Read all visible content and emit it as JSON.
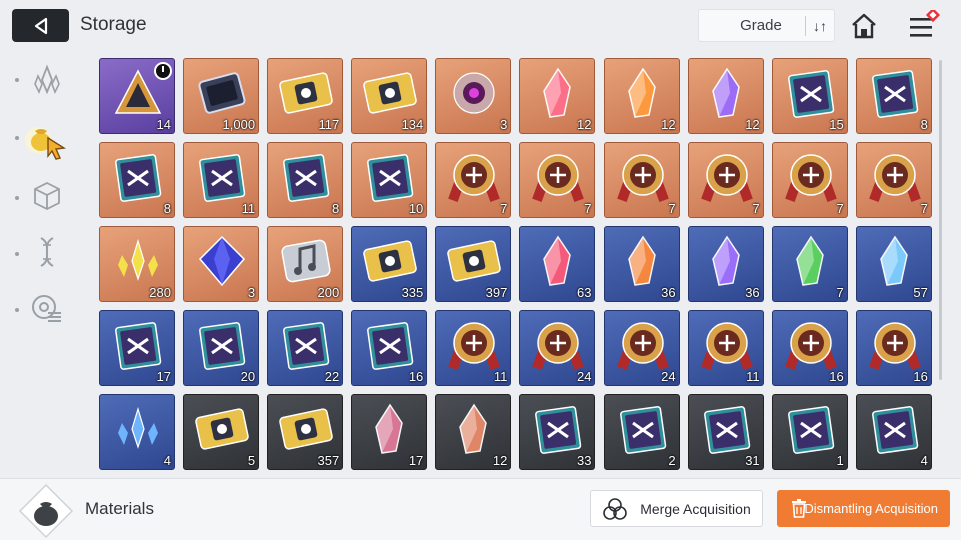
{
  "header": {
    "title": "Storage",
    "sort_label": "Grade",
    "sort_icon": "↓↑"
  },
  "sidebar": {
    "items": [
      {
        "icon": "crystal-icon",
        "active": false
      },
      {
        "icon": "pouch-icon",
        "active": true
      },
      {
        "icon": "cube-icon",
        "active": false
      },
      {
        "icon": "dna-icon",
        "active": false
      },
      {
        "icon": "gear-list-icon",
        "active": false
      }
    ]
  },
  "items": [
    {
      "rarity": "purple",
      "icon": "triangle-token-icon",
      "qty": "14",
      "timer": true
    },
    {
      "rarity": "orange",
      "icon": "chip-icon",
      "qty": "1,000"
    },
    {
      "rarity": "orange",
      "icon": "ticket-icon",
      "qty": "117"
    },
    {
      "rarity": "orange",
      "icon": "ticket-icon",
      "qty": "134"
    },
    {
      "rarity": "orange",
      "icon": "eye-orb-icon",
      "qty": "3"
    },
    {
      "rarity": "orange",
      "icon": "crystal-icon",
      "qty": "12",
      "color": "#ff6e8a"
    },
    {
      "rarity": "orange",
      "icon": "crystal-icon",
      "qty": "12",
      "color": "#ff9a3c"
    },
    {
      "rarity": "orange",
      "icon": "crystal-icon",
      "qty": "12",
      "color": "#9a6bff"
    },
    {
      "rarity": "orange",
      "icon": "book-icon",
      "qty": "15"
    },
    {
      "rarity": "orange",
      "icon": "book-icon",
      "qty": "8"
    },
    {
      "rarity": "orange",
      "icon": "book-icon",
      "qty": "8"
    },
    {
      "rarity": "orange",
      "icon": "book-icon",
      "qty": "11"
    },
    {
      "rarity": "orange",
      "icon": "book-icon",
      "qty": "8"
    },
    {
      "rarity": "orange",
      "icon": "book-icon",
      "qty": "10"
    },
    {
      "rarity": "orange",
      "icon": "medal-icon",
      "qty": "7"
    },
    {
      "rarity": "orange",
      "icon": "medal-icon",
      "qty": "7"
    },
    {
      "rarity": "orange",
      "icon": "medal-icon",
      "qty": "7"
    },
    {
      "rarity": "orange",
      "icon": "medal-icon",
      "qty": "7"
    },
    {
      "rarity": "orange",
      "icon": "medal-icon",
      "qty": "7"
    },
    {
      "rarity": "orange",
      "icon": "medal-icon",
      "qty": "7"
    },
    {
      "rarity": "orange",
      "icon": "shards-icon",
      "qty": "280",
      "color": "#f4e04a"
    },
    {
      "rarity": "orange",
      "icon": "octahedron-icon",
      "qty": "3"
    },
    {
      "rarity": "orange",
      "icon": "music-note-icon",
      "qty": "200"
    },
    {
      "rarity": "blue",
      "icon": "ticket-icon",
      "qty": "335"
    },
    {
      "rarity": "blue",
      "icon": "ticket-icon",
      "qty": "397"
    },
    {
      "rarity": "blue",
      "icon": "crystal-icon",
      "qty": "63",
      "color": "#ff5a78"
    },
    {
      "rarity": "blue",
      "icon": "crystal-icon",
      "qty": "36",
      "color": "#ff8a3a"
    },
    {
      "rarity": "blue",
      "icon": "crystal-icon",
      "qty": "36",
      "color": "#a070ff"
    },
    {
      "rarity": "blue",
      "icon": "crystal-icon",
      "qty": "7",
      "color": "#5cd65c"
    },
    {
      "rarity": "blue",
      "icon": "crystal-icon",
      "qty": "57",
      "color": "#7fd0ff"
    },
    {
      "rarity": "blue",
      "icon": "book-icon",
      "qty": "17"
    },
    {
      "rarity": "blue",
      "icon": "book-icon",
      "qty": "20"
    },
    {
      "rarity": "blue",
      "icon": "book-icon",
      "qty": "22"
    },
    {
      "rarity": "blue",
      "icon": "book-icon",
      "qty": "16"
    },
    {
      "rarity": "blue",
      "icon": "medal-icon",
      "qty": "11"
    },
    {
      "rarity": "blue",
      "icon": "medal-icon",
      "qty": "24"
    },
    {
      "rarity": "blue",
      "icon": "medal-icon",
      "qty": "24"
    },
    {
      "rarity": "blue",
      "icon": "medal-icon",
      "qty": "11"
    },
    {
      "rarity": "blue",
      "icon": "medal-icon",
      "qty": "16"
    },
    {
      "rarity": "blue",
      "icon": "medal-icon",
      "qty": "16"
    },
    {
      "rarity": "blue",
      "icon": "shards-icon",
      "qty": "4",
      "color": "#6fb4ff"
    },
    {
      "rarity": "gray",
      "icon": "ticket-icon",
      "qty": "5"
    },
    {
      "rarity": "gray",
      "icon": "ticket-icon",
      "qty": "357"
    },
    {
      "rarity": "gray",
      "icon": "crystal-icon",
      "qty": "17",
      "color": "#e07a9a"
    },
    {
      "rarity": "gray",
      "icon": "crystal-icon",
      "qty": "12",
      "color": "#e88a6a"
    },
    {
      "rarity": "gray",
      "icon": "book-icon",
      "qty": "33"
    },
    {
      "rarity": "gray",
      "icon": "book-icon",
      "qty": "2"
    },
    {
      "rarity": "gray",
      "icon": "book-icon",
      "qty": "31"
    },
    {
      "rarity": "gray",
      "icon": "book-icon",
      "qty": "1"
    },
    {
      "rarity": "gray",
      "icon": "book-icon",
      "qty": "4"
    }
  ],
  "footer": {
    "category_label": "Materials",
    "merge_label": "Merge Acquisition",
    "dismantle_label": "Dismantling Acquisition"
  },
  "colors": {
    "accent": "#f07b32",
    "purple_rarity": "#6b4fb0",
    "orange_rarity": "#d8875c",
    "blue_rarity": "#3b56a0",
    "gray_rarity": "#3d4045"
  }
}
